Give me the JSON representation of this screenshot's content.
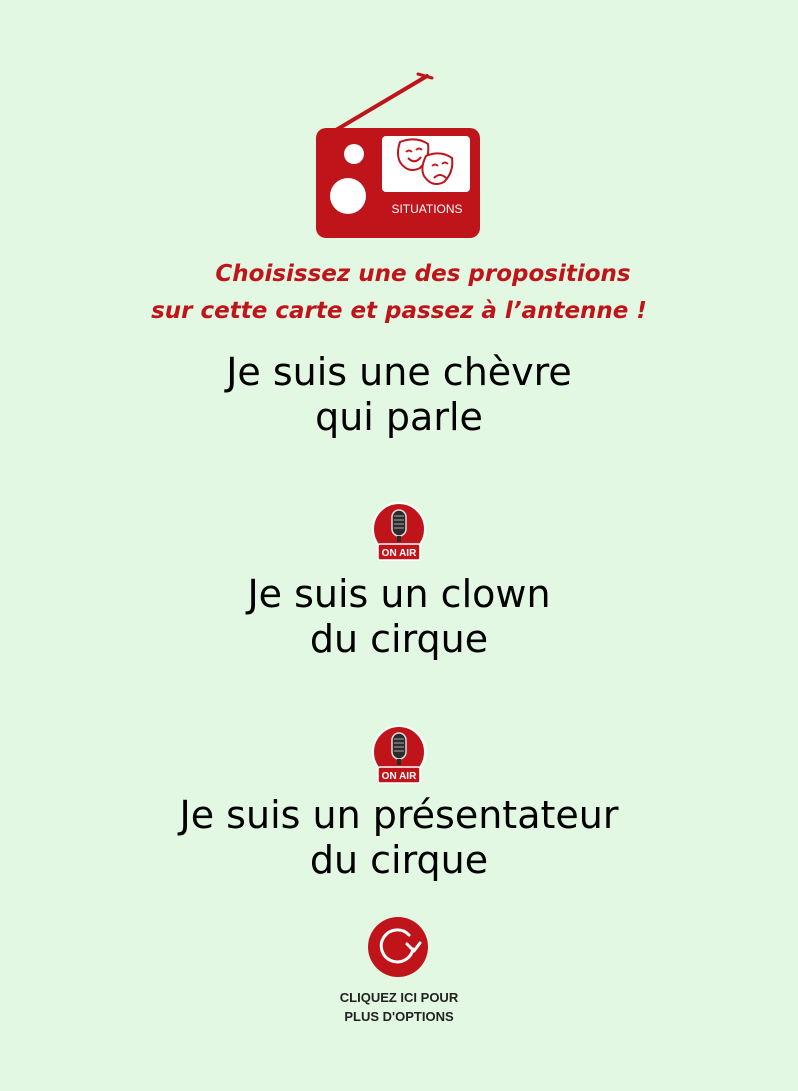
{
  "header": {
    "logo_label": "SITUATIONS",
    "logo_icon": "radio-theater-masks-icon",
    "instruction_line1": "Choisissez une des propositions",
    "instruction_line2": "sur cette carte et passez à l’antenne !"
  },
  "options": [
    {
      "line1": "Je suis une chèvre",
      "line2": "qui parle"
    },
    {
      "line1": "Je suis un clown",
      "line2": "du cirque"
    },
    {
      "line1": "Je suis un présentateur",
      "line2": "du cirque"
    }
  ],
  "separator": {
    "badge_label": "ON AIR",
    "icon": "microphone-on-air-icon"
  },
  "footer": {
    "refresh_icon": "refresh-arrow-icon",
    "more_line1": "CLIQUEZ ICI POUR",
    "more_line2": "PLUS D'OPTIONS"
  },
  "colors": {
    "background": "#e2f8e2",
    "accent_red": "#c0141b",
    "text": "#000000"
  }
}
